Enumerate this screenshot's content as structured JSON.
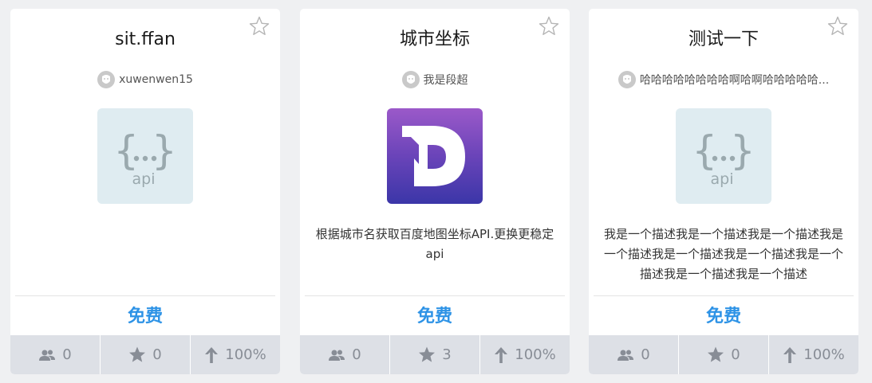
{
  "cards": [
    {
      "title": "sit.ffan",
      "author": "xuwenwen15",
      "logo": "api-braces-icon",
      "description": "",
      "price": "免费",
      "stats": {
        "users": "0",
        "favorites": "0",
        "success_rate": "100%"
      }
    },
    {
      "title": "城市坐标",
      "author": "我是段超",
      "logo": "dash-d-logo",
      "description": "根据城市名获取百度地图坐标API.更换更稳定api",
      "price": "免费",
      "stats": {
        "users": "0",
        "favorites": "3",
        "success_rate": "100%"
      }
    },
    {
      "title": "测试一下",
      "author": "哈哈哈哈哈哈哈哈啊哈啊哈哈哈哈哈...",
      "logo": "api-braces-icon",
      "description": "我是一个描述我是一个描述我是一个描述我是一个描述我是一个描述我是一个描述我是一个描述我是一个描述我是一个描述",
      "price": "免费",
      "stats": {
        "users": "0",
        "favorites": "0",
        "success_rate": "100%"
      }
    }
  ],
  "colors": {
    "page_background": "#eff0f2",
    "card_background": "#ffffff",
    "price_text": "#2e93e6",
    "stats_bar": "#dde0e6",
    "stats_text": "#888d96",
    "api_logo_bg": "#dfecf1",
    "dash_logo_gradient": [
      "#9b59c9",
      "#3b36a8"
    ]
  }
}
